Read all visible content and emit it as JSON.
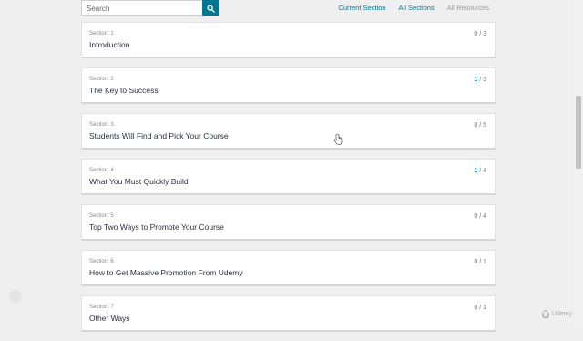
{
  "search": {
    "placeholder": "Search"
  },
  "top_links": {
    "current_section": "Current Section",
    "all_sections": "All Sections",
    "all_resources": "All Resources"
  },
  "sections": [
    {
      "label": "Section: 1",
      "title": "Introduction",
      "done": "0",
      "total": " / 3"
    },
    {
      "label": "Section: 2",
      "title": "The Key to Success",
      "done": "1",
      "total": " / 3"
    },
    {
      "label": "Section: 3",
      "title": "Students Will Find and Pick Your Course",
      "done": "0",
      "total": " / 5"
    },
    {
      "label": "Section: 4",
      "title": "What You Must Quickly Build",
      "done": "1",
      "total": " / 4"
    },
    {
      "label": "Section: 5",
      "title": "Top Two Ways to Promote Your Course",
      "done": "0",
      "total": " / 4"
    },
    {
      "label": "Section: 6",
      "title": "How to Get Massive Promotion From Udemy",
      "done": "0",
      "total": " / 1"
    },
    {
      "label": "Section: 7",
      "title": "Other Ways",
      "done": "0",
      "total": " / 1"
    }
  ],
  "watermark": {
    "text": "Udemy"
  },
  "colors": {
    "accent": "#007791",
    "background": "#efefef",
    "card": "#ffffff",
    "title_text": "#29303b"
  }
}
